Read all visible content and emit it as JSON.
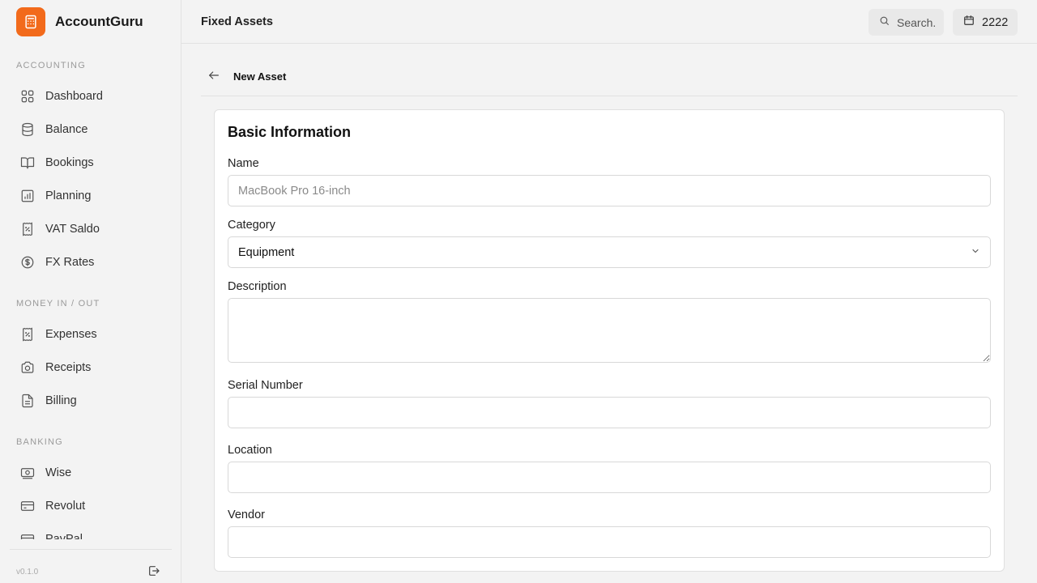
{
  "app": {
    "name": "AccountGuru",
    "version": "v0.1.0"
  },
  "sidebar": {
    "sections": [
      {
        "label": "ACCOUNTING",
        "items": [
          {
            "label": "Dashboard",
            "icon": "grid-icon"
          },
          {
            "label": "Balance",
            "icon": "database-icon"
          },
          {
            "label": "Bookings",
            "icon": "book-icon"
          },
          {
            "label": "Planning",
            "icon": "bar-chart-icon"
          },
          {
            "label": "VAT Saldo",
            "icon": "receipt-percent-icon"
          },
          {
            "label": "FX Rates",
            "icon": "dollar-circle-icon"
          }
        ]
      },
      {
        "label": "MONEY IN / OUT",
        "items": [
          {
            "label": "Expenses",
            "icon": "receipt-icon"
          },
          {
            "label": "Receipts",
            "icon": "camera-icon"
          },
          {
            "label": "Billing",
            "icon": "file-text-icon"
          }
        ]
      },
      {
        "label": "BANKING",
        "items": [
          {
            "label": "Wise",
            "icon": "banknote-icon"
          },
          {
            "label": "Revolut",
            "icon": "credit-card-icon"
          },
          {
            "label": "PayPal",
            "icon": "credit-card-icon"
          }
        ]
      }
    ]
  },
  "header": {
    "title": "Fixed Assets",
    "search_label": "Search.",
    "year_label": "2222"
  },
  "subheader": {
    "title": "New Asset"
  },
  "form": {
    "section_title": "Basic Information",
    "name": {
      "label": "Name",
      "placeholder": "MacBook Pro 16-inch",
      "value": ""
    },
    "category": {
      "label": "Category",
      "value": "Equipment"
    },
    "description": {
      "label": "Description",
      "value": ""
    },
    "serial_number": {
      "label": "Serial Number",
      "value": ""
    },
    "location": {
      "label": "Location",
      "value": ""
    },
    "vendor": {
      "label": "Vendor",
      "value": ""
    }
  },
  "colors": {
    "brand": "#f26a1b",
    "background": "#f3f3f3",
    "card": "#ffffff",
    "border": "#e0e0e0"
  }
}
